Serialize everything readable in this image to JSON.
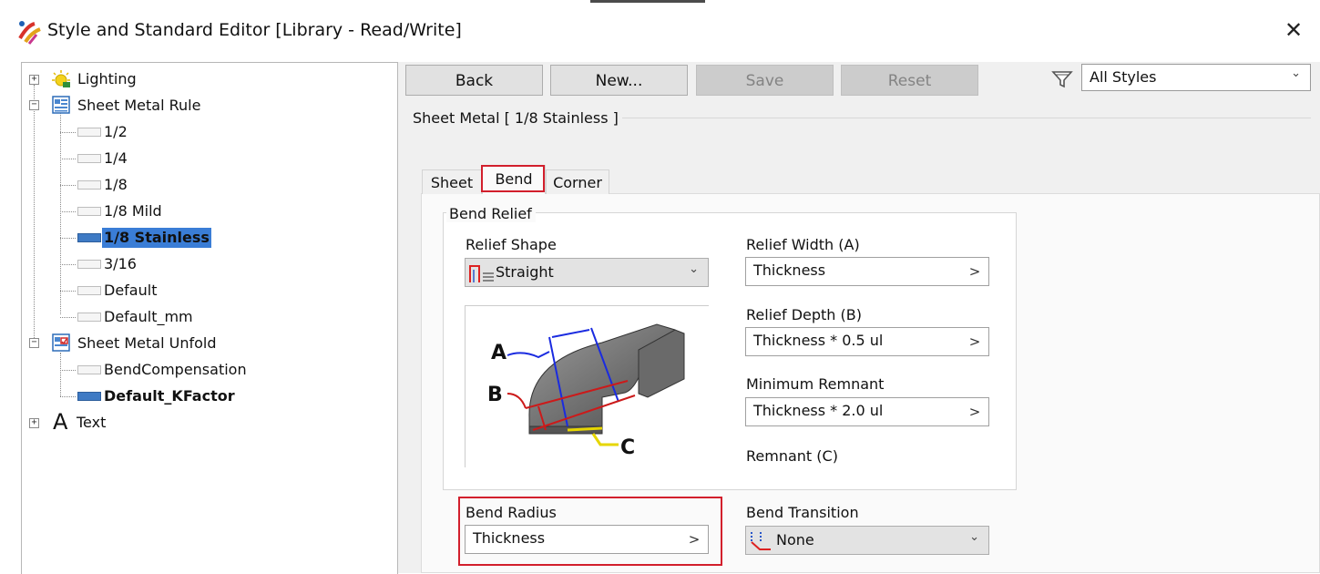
{
  "window": {
    "title": "Style and Standard Editor [Library - Read/Write]",
    "close_glyph": "✕"
  },
  "tree": {
    "items": [
      {
        "label": "Lighting",
        "icon": "lighting-icon",
        "expander": "+"
      },
      {
        "label": "Sheet Metal Rule",
        "icon": "sheet-metal-rule-icon",
        "expander": "−"
      },
      {
        "label": "1/2",
        "icon": "style-leaf-icon"
      },
      {
        "label": "1/4",
        "icon": "style-leaf-icon"
      },
      {
        "label": "1/8",
        "icon": "style-leaf-icon"
      },
      {
        "label": "1/8 Mild",
        "icon": "style-leaf-icon"
      },
      {
        "label": "1/8 Stainless",
        "icon": "style-leaf-icon",
        "selected": true
      },
      {
        "label": "3/16",
        "icon": "style-leaf-icon"
      },
      {
        "label": "Default",
        "icon": "style-leaf-icon"
      },
      {
        "label": "Default_mm",
        "icon": "style-leaf-icon"
      },
      {
        "label": "Sheet Metal Unfold",
        "icon": "sheet-metal-unfold-icon",
        "expander": "−"
      },
      {
        "label": "BendCompensation",
        "icon": "style-leaf-icon"
      },
      {
        "label": "Default_KFactor",
        "icon": "style-leaf-icon",
        "active": true
      },
      {
        "label": "Text",
        "icon": "text-icon",
        "expander": "+",
        "icon_glyph": "A"
      }
    ]
  },
  "toolbar": {
    "back": "Back",
    "new": "New...",
    "save": "Save",
    "reset": "Reset",
    "filter_value": "All Styles"
  },
  "style_heading": "Sheet Metal [ 1/8 Stainless ]",
  "tabs": [
    {
      "label": "Sheet"
    },
    {
      "label": "Bend",
      "active": true
    },
    {
      "label": "Corner"
    }
  ],
  "bend_relief": {
    "group_title": "Bend Relief",
    "relief_shape_label": "Relief Shape",
    "relief_shape_value": "Straight",
    "relief_width_label": "Relief Width (A)",
    "relief_width_value": "Thickness",
    "relief_depth_label": "Relief Depth (B)",
    "relief_depth_value": "Thickness * 0.5 ul",
    "min_remnant_label": "Minimum Remnant",
    "min_remnant_value": "Thickness * 2.0 ul",
    "remnant_label": "Remnant (C)",
    "illustration_labels": {
      "a": "A",
      "b": "B",
      "c": "C"
    }
  },
  "bend_radius": {
    "label": "Bend Radius",
    "value": "Thickness"
  },
  "bend_transition": {
    "label": "Bend Transition",
    "value": "None"
  },
  "glyphs": {
    "chevron_down": "⌄",
    "arrow_right": ">"
  },
  "colors": {
    "selection_blue": "#3a7dd6",
    "highlight_red": "#d21f2c",
    "line_blue": "#1a2be0",
    "line_red": "#cc1a1a",
    "line_yellow": "#e6d600"
  }
}
